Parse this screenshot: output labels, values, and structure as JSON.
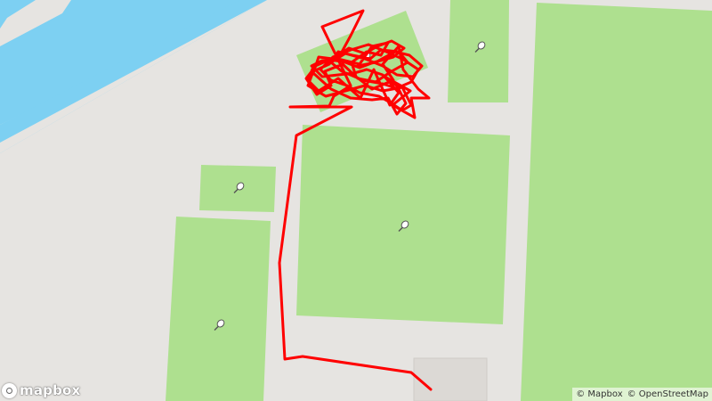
{
  "map": {
    "colors": {
      "background": "#e6e4e1",
      "water": "#7dd0f2",
      "water_edge": "#9bb8d6",
      "pitch": "#aee08f",
      "building": "#dcd9d5",
      "track": "#ff0000"
    },
    "pitch_icon": "tennis-racket-icon",
    "track_style": "red GPS track line"
  },
  "branding": {
    "logo_text": "mapbox"
  },
  "attribution": {
    "mapbox": "© Mapbox",
    "osm": "© OpenStreetMap"
  }
}
